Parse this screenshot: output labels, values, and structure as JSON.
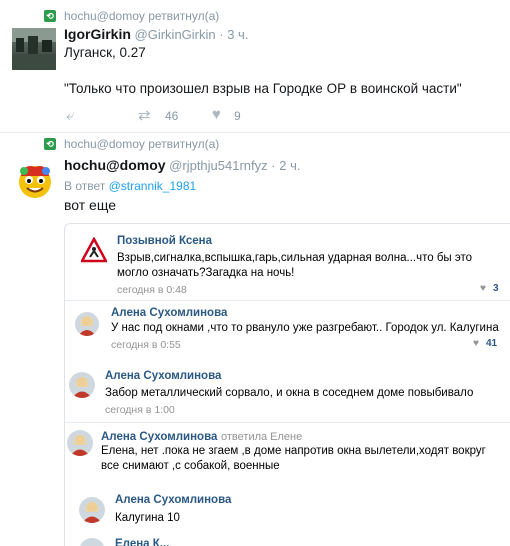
{
  "tweet1": {
    "retweet_line": "hochu@domoy ретвитнул(а)",
    "name": "IgorGirkin",
    "handle": "@GirkinGirkin",
    "dot": "·",
    "time": "3 ч.",
    "line1": "Луганск, 0.27",
    "line2": "\"Только что произошел взрыв на Городке ОР в воинской части\"",
    "retweets": "46",
    "likes": "9"
  },
  "tweet2": {
    "retweet_line": "hochu@domoy ретвитнул(а)",
    "name": "hochu@domoy",
    "handle": "@rjpthju541rnfyz",
    "dot": "·",
    "time": "2 ч.",
    "reply_prefix": "В ответ",
    "reply_to": "@strannik_1981",
    "text": "вот еще"
  },
  "comments": [
    {
      "name": "Позывной Ксена",
      "text": "Взрыв,сигналка,вспышка,гарь,сильная ударная волна...что бы это могло означать?Загадка на ночь!",
      "time": "сегодня в 0:48",
      "likes": "3"
    },
    {
      "name": "Алена Сухомлинова",
      "text": "У нас под окнами ,что то рвануло уже разгребают.. Городок ул. Калугина",
      "time": "сегодня в 0:55",
      "likes": "41"
    },
    {
      "name": "Алена Сухомлинова",
      "text": "Забор металлический сорвало, и окна в соседнем доме повыбивало",
      "time": "сегодня в 1:00"
    },
    {
      "name": "Алена Сухомлинова",
      "reply_note": "ответила Елене",
      "text": "Елена, нет .пока не згаем ,в доме напротив окна вылетели,ходят вокруг все снимают ,с собакой, военные"
    },
    {
      "name": "Алена Сухомлинова",
      "text": "Калугина 10"
    },
    {
      "name": "Елена К..."
    }
  ],
  "colors": {
    "accent": "#1da1f2",
    "vk_link": "#2a5885",
    "rt_green": "#2e9a4c"
  }
}
